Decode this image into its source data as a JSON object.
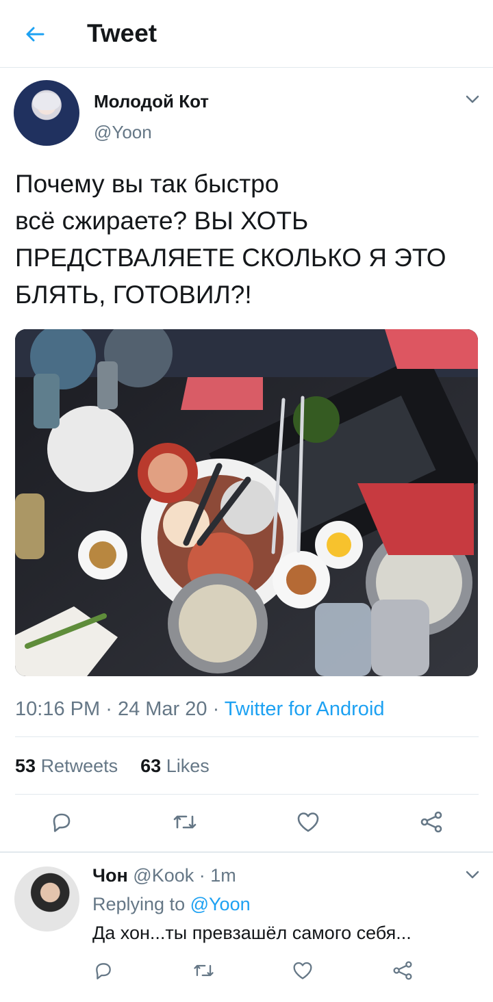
{
  "header": {
    "title": "Tweet",
    "back_icon": "arrow-left-icon"
  },
  "tweet": {
    "author_name": "Молодой Кот",
    "author_handle": "@Yoon",
    "text_lines": [
      "Почему вы так быстро",
      "всё сжираете? ВЫ ХОТЬ",
      "ПРЕДСТВАЛЯЕТЕ СКОЛЬКО Я ЭТО",
      "БЛЯТЬ, ГОТОВИЛ?!"
    ],
    "time": "10:16 PM",
    "date": "24 Mar 20",
    "separator": "·",
    "source": "Twitter for Android",
    "retweet_count": "53",
    "retweet_label": "Retweets",
    "like_count": "63",
    "like_label": "Likes"
  },
  "reply": {
    "author_name": "Чон",
    "author_handle": "@Kook",
    "separator": "·",
    "time": "1m",
    "replying_prefix": "Replying to",
    "replying_mention": "@Yoon",
    "text": "Да хон...ты превзашёл самого себя..."
  },
  "icons": {
    "reply": "reply-icon",
    "retweet": "retweet-icon",
    "like": "heart-icon",
    "share": "share-icon",
    "menu": "chevron-down-icon"
  },
  "colors": {
    "accent": "#1da1f2",
    "text": "#14171a",
    "secondary": "#657786",
    "divider": "#e1e8ed"
  }
}
